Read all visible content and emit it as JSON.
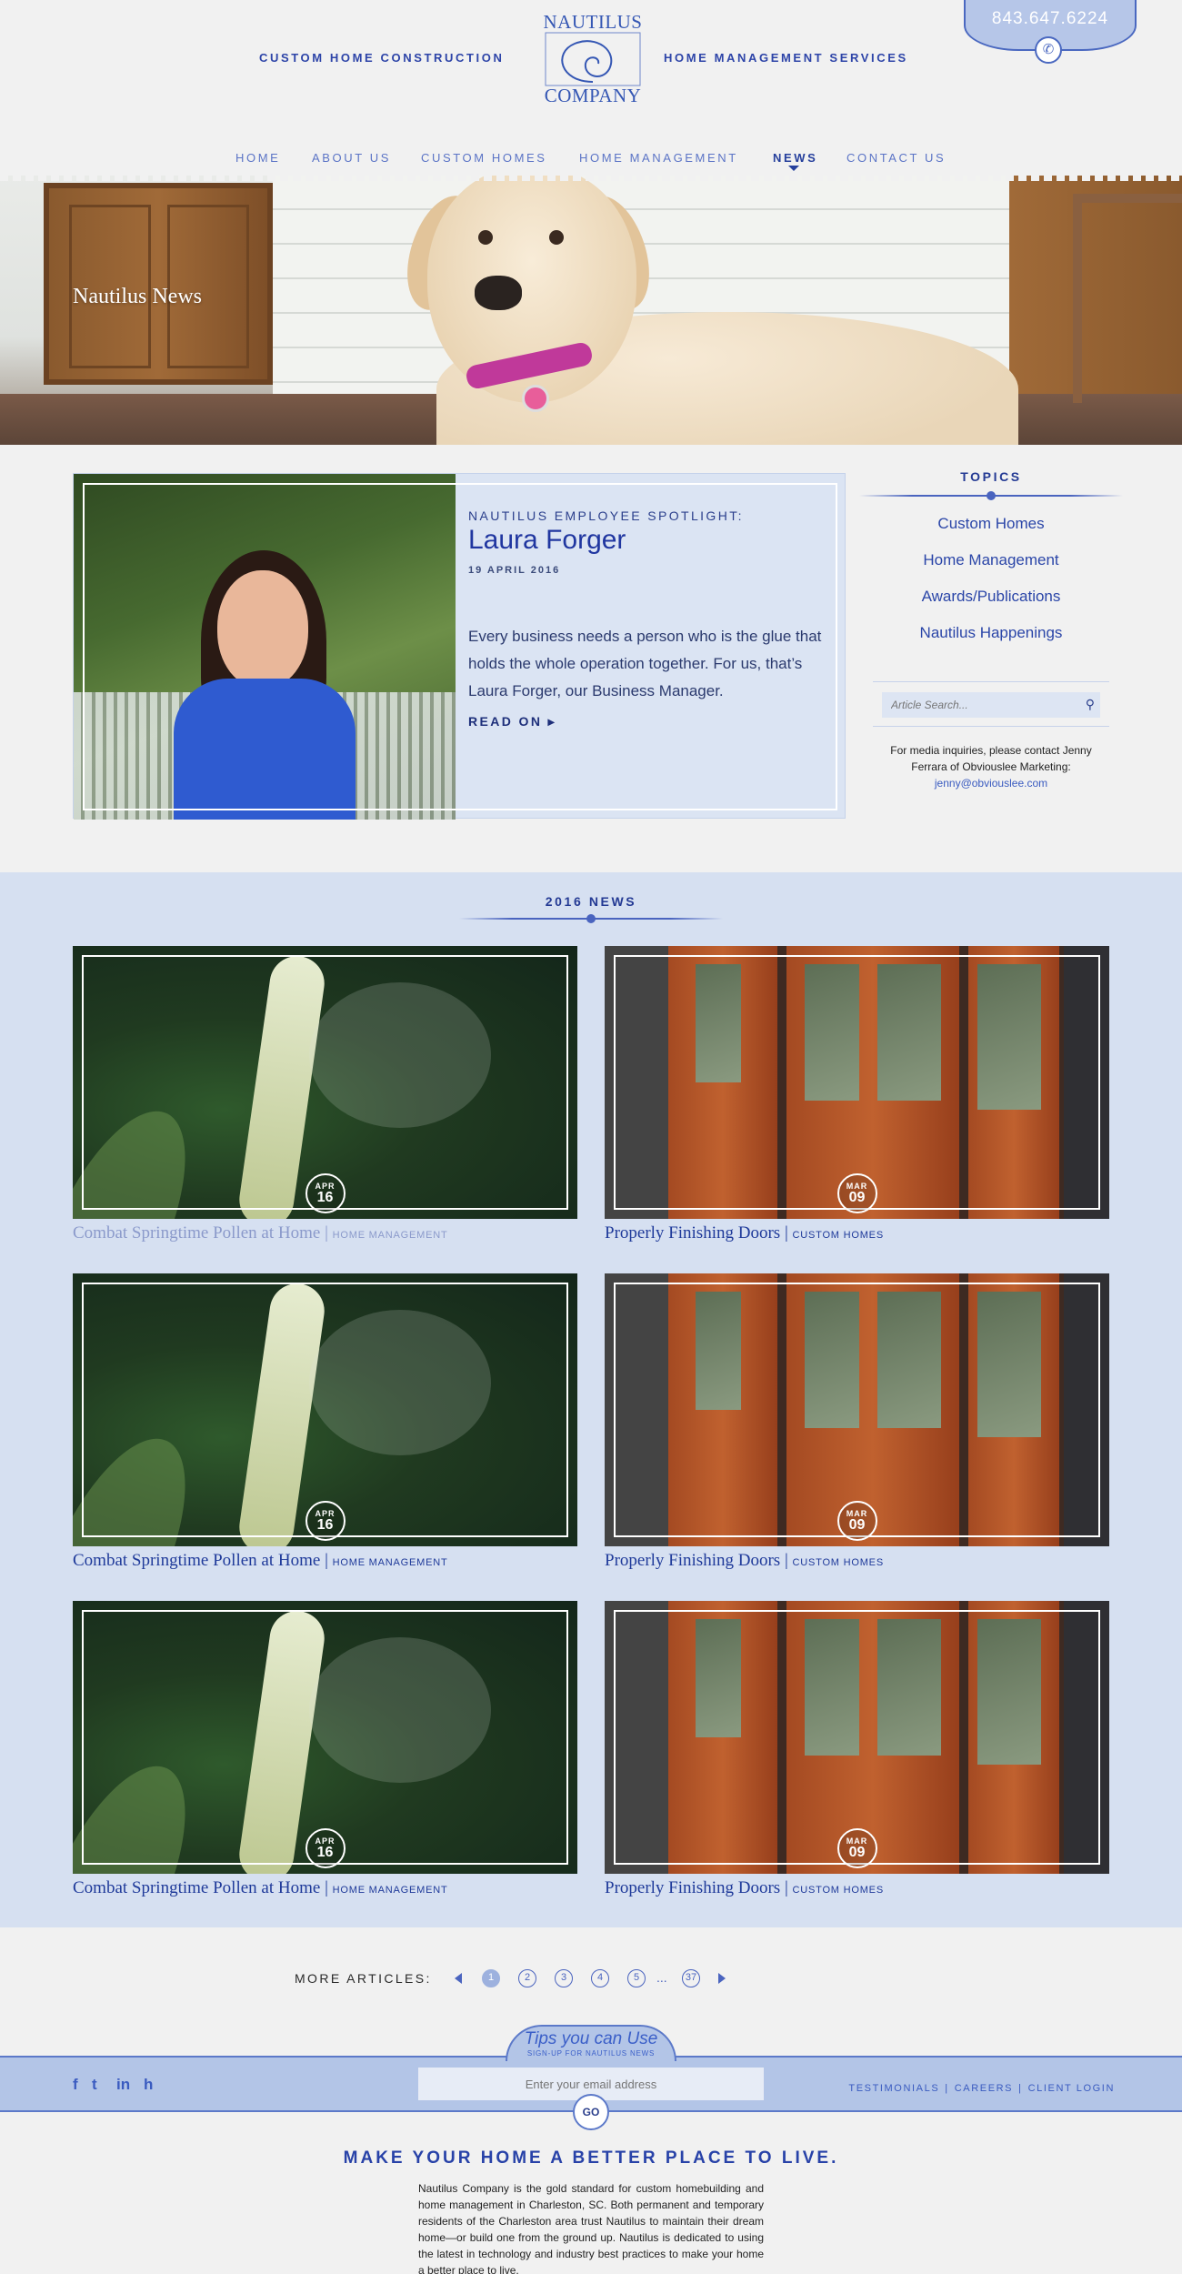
{
  "header": {
    "left_tagline": "CUSTOM HOME CONSTRUCTION",
    "right_tagline": "HOME MANAGEMENT SERVICES",
    "logo_top": "NAUTILUS",
    "logo_bottom": "COMPANY",
    "phone": "843.647.6224"
  },
  "nav": {
    "items": [
      "HOME",
      "ABOUT US",
      "CUSTOM HOMES",
      "HOME MANAGEMENT",
      "NEWS",
      "CONTACT US"
    ],
    "active": "NEWS"
  },
  "hero": {
    "title": "Nautilus News"
  },
  "featured": {
    "kicker": "NAUTILUS EMPLOYEE SPOTLIGHT:",
    "name": "Laura Forger",
    "date": "19 APRIL 2016",
    "excerpt": "Every business needs a person who is the glue that holds the whole operation together. For us, that’s Laura Forger, our Business Manager.",
    "read_on": "READ ON"
  },
  "topics": {
    "heading": "TOPICS",
    "items": [
      "Custom Homes",
      "Home Management",
      "Awards/Publications",
      "Nautilus Happenings"
    ],
    "search_placeholder": "Article Search...",
    "media_note": "For media inquiries, please contact Jenny Ferrara of Obviouslee Marketing:",
    "media_email": "jenny@obviouslee.com"
  },
  "news": {
    "heading": "2016 NEWS",
    "articles": [
      {
        "title": "Combat Springtime Pollen at Home",
        "category": "HOME MANAGEMENT",
        "month": "APR",
        "day": "16"
      },
      {
        "title": "Properly Finishing Doors",
        "category": "CUSTOM HOMES",
        "month": "MAR",
        "day": "09"
      },
      {
        "title": "Combat Springtime Pollen at Home",
        "category": "HOME MANAGEMENT",
        "month": "APR",
        "day": "16"
      },
      {
        "title": "Properly Finishing Doors",
        "category": "CUSTOM HOMES",
        "month": "MAR",
        "day": "09"
      },
      {
        "title": "Combat Springtime Pollen at Home",
        "category": "HOME MANAGEMENT",
        "month": "APR",
        "day": "16"
      },
      {
        "title": "Properly Finishing Doors",
        "category": "CUSTOM HOMES",
        "month": "MAR",
        "day": "09"
      }
    ]
  },
  "pagination": {
    "label": "MORE ARTICLES:",
    "pages": [
      "1",
      "2",
      "3",
      "4",
      "5"
    ],
    "ellipsis": "...",
    "last": "37",
    "current": "1"
  },
  "footer": {
    "tips_title": "Tips you can Use",
    "tips_sub": "SIGN-UP FOR NAUTILUS NEWS",
    "email_placeholder": "Enter your email address",
    "go": "GO",
    "links": [
      "TESTIMONIALS",
      "CAREERS",
      "CLIENT LOGIN"
    ],
    "social": [
      "f",
      "t",
      "in",
      "h"
    ],
    "tagline": "MAKE YOUR HOME A BETTER PLACE TO LIVE.",
    "about": "Nautilus Company is the gold standard for custom homebuilding and home management in Charleston, SC. Both permanent and temporary residents of the Charleston area trust Nautilus to maintain their dream home—or build one from the ground up. Nautilus is dedicated to using the latest in technology and industry best practices to make your home a better place to live."
  },
  "colors": {
    "brand_blue": "#2b3f8c",
    "accent_blue": "#4a64bf",
    "band_blue": "#d6e0f1"
  }
}
